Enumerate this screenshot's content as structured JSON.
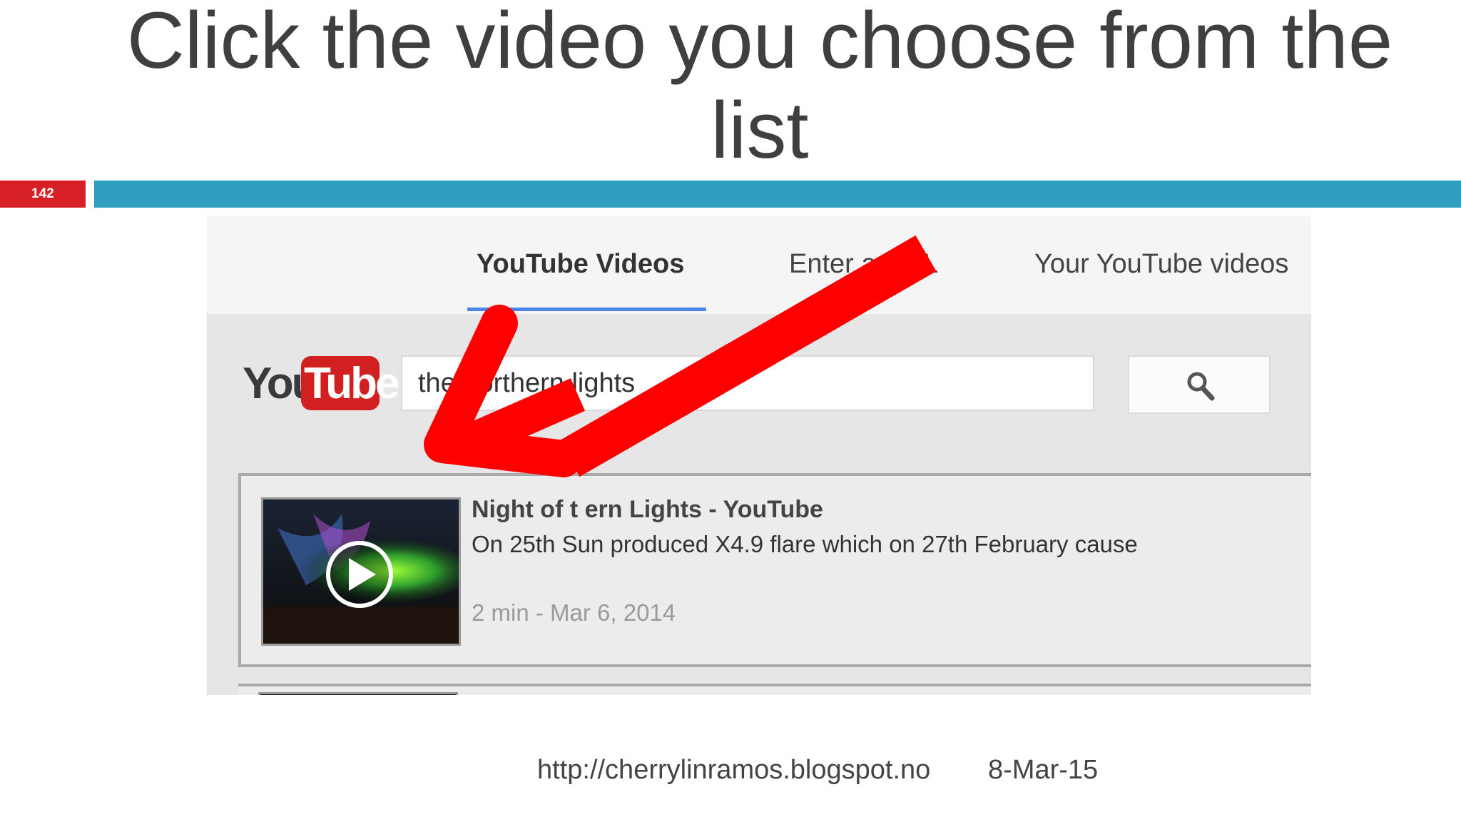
{
  "slide": {
    "title": "Click the video you choose from the list",
    "number": "142",
    "footer_url": "http://cherrylinramos.blogspot.no",
    "footer_date": "8-Mar-15"
  },
  "tabs": [
    {
      "label": "YouTube Videos",
      "active": true
    },
    {
      "label": "Enter a URL",
      "active": false
    },
    {
      "label": "Your YouTube videos",
      "active": false
    }
  ],
  "logo": {
    "you": "You",
    "tube": "Tube"
  },
  "search": {
    "value": "the northern lights",
    "button_icon": "search-icon"
  },
  "results": [
    {
      "title": "Night of the Northern Lights - YouTube",
      "title_visible": "Night of t          ern Lights - YouTube",
      "description": "On 25th            Sun produced X4.9 flare which on 27th February cause",
      "meta": "2 min - Mar 6, 2014",
      "thumbnail": "northern-lights-thumbnail"
    }
  ],
  "annotation": {
    "arrow_color": "#ff0000",
    "arrow_direction": "down-left"
  },
  "colors": {
    "title_bar": "#2f9fbf",
    "slide_number_bg": "#d71f26",
    "tab_underline": "#4a86e8",
    "youtube_red": "#d21f1f"
  }
}
